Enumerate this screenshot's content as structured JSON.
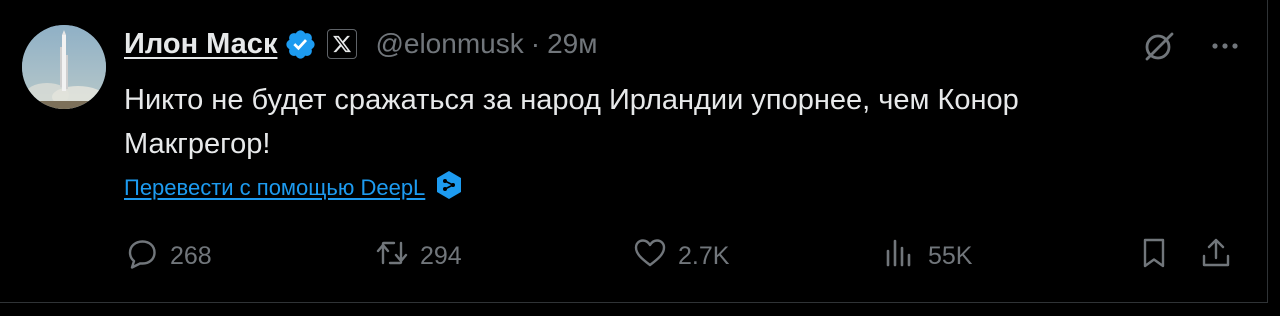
{
  "author": {
    "display_name": "Илон Маск",
    "handle": "@elonmusk",
    "separator": "·",
    "time": "29м",
    "verified_color": "#1d9bf0"
  },
  "tweet": {
    "text": "Никто не будет сражаться за народ Ирландии упорнее, чем Конор Макгрегор!",
    "translate_label": "Перевести с помощью DeepL"
  },
  "actions": {
    "replies": "268",
    "reposts": "294",
    "likes": "2.7K",
    "views": "55K"
  },
  "colors": {
    "background": "#000000",
    "text": "#e7e9ea",
    "secondary": "#71767b",
    "link": "#1d9bf0",
    "border": "#2f3336"
  },
  "icons": {
    "top_right": [
      "grok-icon",
      "more-icon"
    ],
    "actions": [
      "reply-icon",
      "repost-icon",
      "like-icon",
      "views-icon",
      "bookmark-icon",
      "share-icon"
    ]
  }
}
